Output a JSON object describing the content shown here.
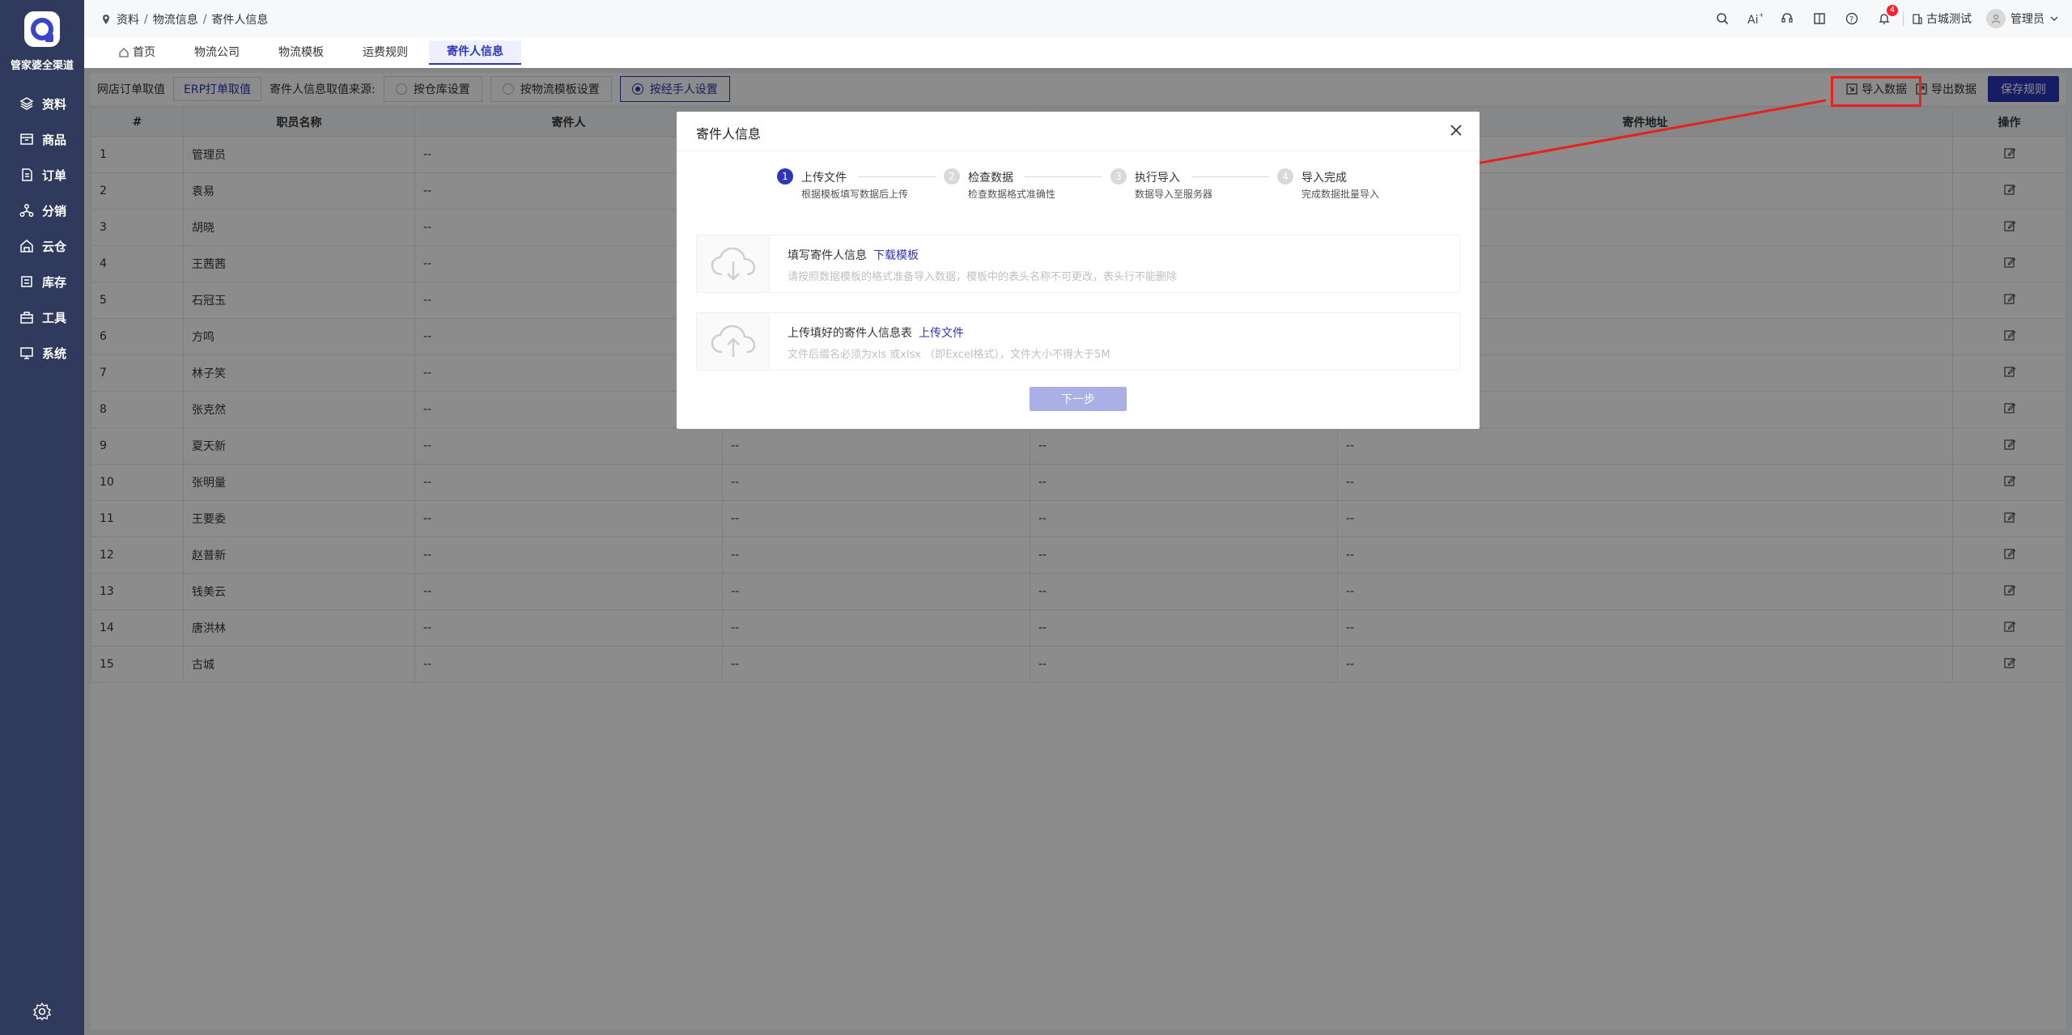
{
  "sidebar": {
    "brand": "管家婆全渠道",
    "items": [
      {
        "label": "资料",
        "icon": "layers-icon"
      },
      {
        "label": "商品",
        "icon": "box-icon"
      },
      {
        "label": "订单",
        "icon": "file-icon"
      },
      {
        "label": "分销",
        "icon": "network-icon"
      },
      {
        "label": "云仓",
        "icon": "warehouse-icon"
      },
      {
        "label": "库存",
        "icon": "stack-icon"
      },
      {
        "label": "工具",
        "icon": "toolbox-icon"
      },
      {
        "label": "系统",
        "icon": "monitor-icon"
      }
    ]
  },
  "header": {
    "breadcrumb": [
      "资料",
      "物流信息",
      "寄件人信息"
    ],
    "notification_count": "4",
    "org_name": "古城测试",
    "user_name": "管理员"
  },
  "tabs": [
    {
      "label": "首页"
    },
    {
      "label": "物流公司"
    },
    {
      "label": "物流模板"
    },
    {
      "label": "运费规则"
    },
    {
      "label": "寄件人信息",
      "active": true
    }
  ],
  "toolbar": {
    "online_order_label": "网店订单取值",
    "erp_print_label": "ERP打单取值",
    "source_label": "寄件人信息取值来源:",
    "options": [
      {
        "label": "按仓库设置",
        "selected": false
      },
      {
        "label": "按物流模板设置",
        "selected": false
      },
      {
        "label": "按经手人设置",
        "selected": true
      }
    ],
    "import_label": "导入数据",
    "export_label": "导出数据",
    "save_label": "保存规则"
  },
  "table": {
    "headers": [
      "#",
      "职员名称",
      "寄件人",
      "",
      "",
      "寄件地址",
      "操作"
    ],
    "rows": [
      {
        "no": "1",
        "name": "管理员",
        "sender": "--",
        "c3": "",
        "c4": "",
        "c5": ""
      },
      {
        "no": "2",
        "name": "袁易",
        "sender": "--",
        "c3": "",
        "c4": "",
        "c5": ""
      },
      {
        "no": "3",
        "name": "胡晓",
        "sender": "--",
        "c3": "",
        "c4": "",
        "c5": ""
      },
      {
        "no": "4",
        "name": "王茜茜",
        "sender": "--",
        "c3": "",
        "c4": "",
        "c5": ""
      },
      {
        "no": "5",
        "name": "石冠玉",
        "sender": "--",
        "c3": "",
        "c4": "",
        "c5": ""
      },
      {
        "no": "6",
        "name": "方鸣",
        "sender": "--",
        "c3": "",
        "c4": "",
        "c5": ""
      },
      {
        "no": "7",
        "name": "林子笑",
        "sender": "--",
        "c3": "",
        "c4": "",
        "c5": ""
      },
      {
        "no": "8",
        "name": "张克然",
        "sender": "--",
        "c3": "",
        "c4": "",
        "c5": ""
      },
      {
        "no": "9",
        "name": "夏天新",
        "sender": "--",
        "c3": "--",
        "c4": "--",
        "c5": "--"
      },
      {
        "no": "10",
        "name": "张明量",
        "sender": "--",
        "c3": "--",
        "c4": "--",
        "c5": "--"
      },
      {
        "no": "11",
        "name": "王要委",
        "sender": "--",
        "c3": "--",
        "c4": "--",
        "c5": "--"
      },
      {
        "no": "12",
        "name": "赵普新",
        "sender": "--",
        "c3": "--",
        "c4": "--",
        "c5": "--"
      },
      {
        "no": "13",
        "name": "钱美云",
        "sender": "--",
        "c3": "--",
        "c4": "--",
        "c5": "--"
      },
      {
        "no": "14",
        "name": "唐洪林",
        "sender": "--",
        "c3": "--",
        "c4": "--",
        "c5": "--"
      },
      {
        "no": "15",
        "name": "古城",
        "sender": "--",
        "c3": "--",
        "c4": "--",
        "c5": "--"
      }
    ]
  },
  "modal": {
    "title": "寄件人信息",
    "steps": [
      {
        "num": "1",
        "title": "上传文件",
        "desc": "根据模板填写数据后上传"
      },
      {
        "num": "2",
        "title": "检查数据",
        "desc": "检查数据格式准确性"
      },
      {
        "num": "3",
        "title": "执行导入",
        "desc": "数据导入至服务器"
      },
      {
        "num": "4",
        "title": "导入完成",
        "desc": "完成数据批量导入"
      }
    ],
    "card1": {
      "title": "填写寄件人信息",
      "link": "下载模板",
      "desc": "请按照数据模板的格式准备导入数据，模板中的表头名称不可更改，表头行不能删除"
    },
    "card2": {
      "title": "上传填好的寄件人信息表",
      "link": "上传文件",
      "desc": "文件后缀名必须为xls 或xlsx （即Excel格式），文件大小不得大于5M"
    },
    "next_label": "下一步"
  },
  "colors": {
    "sidebar_bg": "#2f3a5c",
    "primary": "#2b36b8",
    "annotation_red": "#e8211d"
  }
}
